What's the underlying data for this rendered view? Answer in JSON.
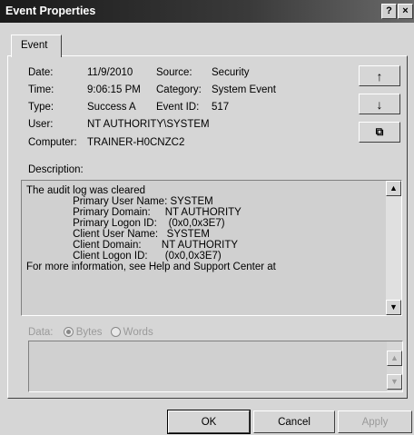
{
  "window": {
    "title": "Event Properties",
    "help_glyph": "?",
    "close_glyph": "×"
  },
  "tabs": [
    {
      "label": "Event"
    }
  ],
  "fields": {
    "date_label": "Date:",
    "date_value": "11/9/2010",
    "source_label": "Source:",
    "source_value": "Security",
    "time_label": "Time:",
    "time_value": "9:06:15 PM",
    "category_label": "Category:",
    "category_value": "System Event",
    "type_label": "Type:",
    "type_value": "Success A",
    "eventid_label": "Event ID:",
    "eventid_value": "517",
    "user_label": "User:",
    "user_value": "NT AUTHORITY\\SYSTEM",
    "computer_label": "Computer:",
    "computer_value": "TRAINER-H0CNZC2"
  },
  "side_buttons": {
    "up_glyph": "↑",
    "down_glyph": "↓",
    "copy_glyph": "⧉"
  },
  "description": {
    "label": "Description:",
    "lines": [
      "The audit log was cleared",
      "                Primary User Name: SYSTEM",
      "                Primary Domain:     NT AUTHORITY",
      "                Primary Logon ID:    (0x0,0x3E7)",
      "                Client User Name:   SYSTEM",
      "                Client Domain:       NT AUTHORITY",
      "                Client Logon ID:      (0x0,0x3E7)",
      "",
      "",
      "For more information, see Help and Support Center at"
    ]
  },
  "data_section": {
    "label": "Data:",
    "bytes_label": "Bytes",
    "words_label": "Words",
    "selected": "Bytes"
  },
  "buttons": {
    "ok": "OK",
    "cancel": "Cancel",
    "apply": "Apply"
  },
  "scroll_glyphs": {
    "up": "▲",
    "down": "▼"
  }
}
